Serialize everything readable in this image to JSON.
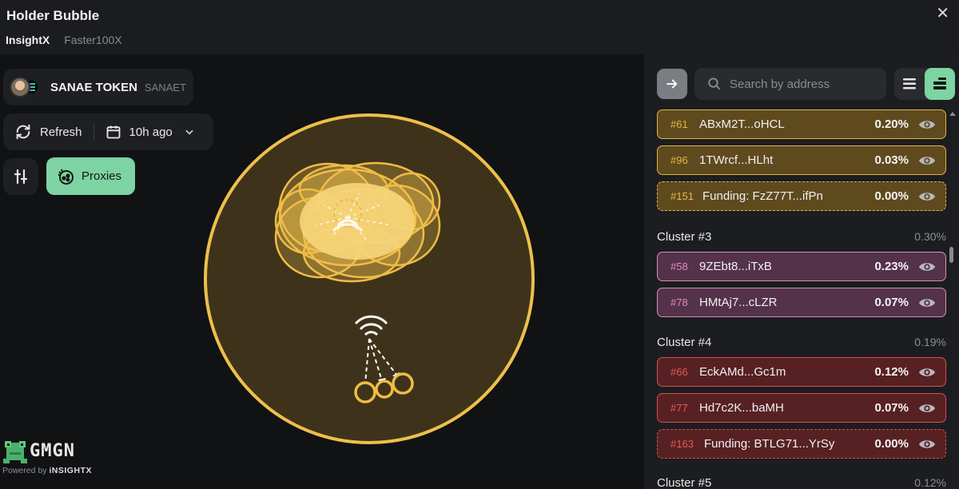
{
  "window": {
    "title": "Holder Bubble",
    "close_glyph": "✕"
  },
  "tabs": [
    {
      "label": "InsightX",
      "active": true
    },
    {
      "label": "Faster100X",
      "active": false
    }
  ],
  "token": {
    "name": "SANAE TOKEN",
    "symbol": "SANAET",
    "chain_icon": "solana-icon"
  },
  "toolbar": {
    "refresh_label": "Refresh",
    "time_label": "10h ago",
    "proxies_label": "Proxies"
  },
  "brand": {
    "logo_text": "GMGN",
    "powered_by": "Powered by",
    "powered_brand": "iNSIGHTX"
  },
  "search": {
    "placeholder": "Search by address"
  },
  "colors": {
    "accent": "#7ed3a3",
    "gold": "#e3b245",
    "pink": "#d58fb8",
    "red": "#d6504d"
  },
  "holders_top": [
    {
      "rank": "#61",
      "address": "ABxM2T...oHCL",
      "percent": "0.20%",
      "funding": false
    },
    {
      "rank": "#96",
      "address": "1TWrcf...HLht",
      "percent": "0.03%",
      "funding": false
    },
    {
      "rank": "#151",
      "address": "Funding: FzZ77T...ifPn",
      "percent": "0.00%",
      "funding": true
    }
  ],
  "clusters": [
    {
      "name": "Cluster #3",
      "percent": "0.30%",
      "holders": [
        {
          "rank": "#58",
          "address": "9ZEbt8...iTxB",
          "percent": "0.23%"
        },
        {
          "rank": "#78",
          "address": "HMtAj7...cLZR",
          "percent": "0.07%"
        }
      ]
    },
    {
      "name": "Cluster #4",
      "percent": "0.19%",
      "holders": [
        {
          "rank": "#66",
          "address": "EckAMd...Gc1m",
          "percent": "0.12%"
        },
        {
          "rank": "#77",
          "address": "Hd7c2K...baMH",
          "percent": "0.07%"
        },
        {
          "rank": "#163",
          "address": "Funding: BTLG71...YrSy",
          "percent": "0.00%"
        }
      ]
    },
    {
      "name": "Cluster #5",
      "percent": "0.12%",
      "holders": []
    }
  ]
}
